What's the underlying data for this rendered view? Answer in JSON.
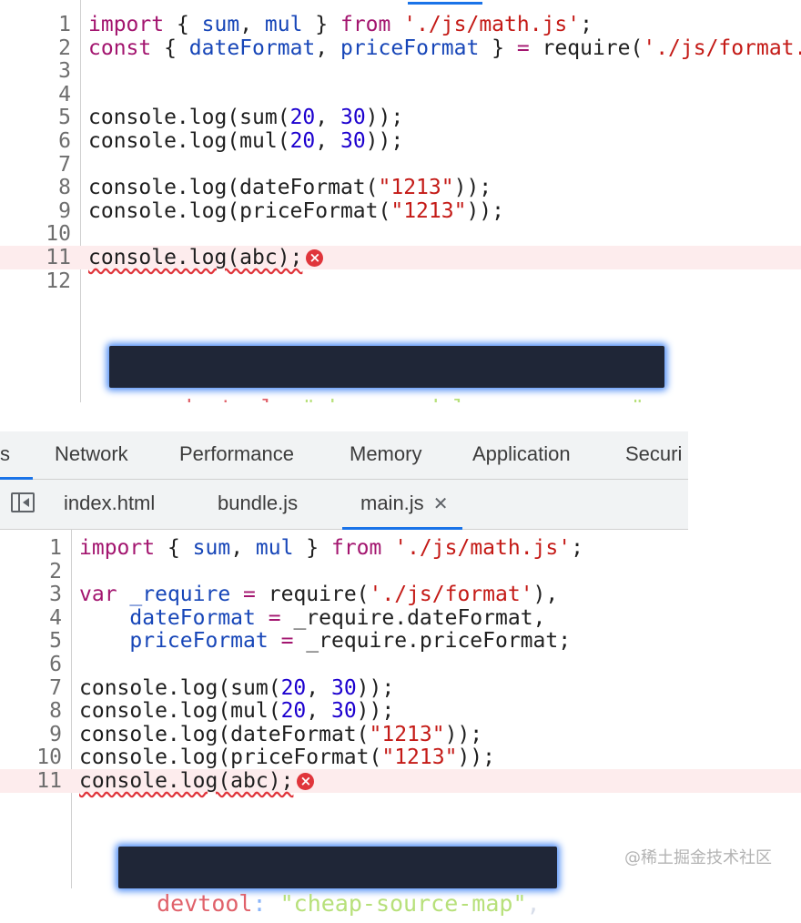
{
  "top_editor": {
    "lines": [
      {
        "no": "1",
        "tokens": [
          [
            "kw",
            "import"
          ],
          [
            "def",
            " { "
          ],
          [
            "var",
            "sum"
          ],
          [
            "def",
            ", "
          ],
          [
            "var",
            "mul"
          ],
          [
            "def",
            " } "
          ],
          [
            "kw",
            "from"
          ],
          [
            "def",
            " "
          ],
          [
            "str",
            "'./js/math.js'"
          ],
          [
            "def",
            ";"
          ]
        ]
      },
      {
        "no": "2",
        "tokens": [
          [
            "kw",
            "const"
          ],
          [
            "def",
            " { "
          ],
          [
            "var",
            "dateFormat"
          ],
          [
            "def",
            ", "
          ],
          [
            "var",
            "priceFormat"
          ],
          [
            "def",
            " } "
          ],
          [
            "op",
            "="
          ],
          [
            "def",
            " require("
          ],
          [
            "str",
            "'./js/format.js'"
          ],
          [
            "def",
            ");"
          ]
        ]
      },
      {
        "no": "3",
        "tokens": []
      },
      {
        "no": "4",
        "tokens": []
      },
      {
        "no": "5",
        "tokens": [
          [
            "def",
            "console.log(sum("
          ],
          [
            "num",
            "20"
          ],
          [
            "def",
            ", "
          ],
          [
            "num",
            "30"
          ],
          [
            "def",
            "));"
          ]
        ]
      },
      {
        "no": "6",
        "tokens": [
          [
            "def",
            "console.log(mul("
          ],
          [
            "num",
            "20"
          ],
          [
            "def",
            ", "
          ],
          [
            "num",
            "30"
          ],
          [
            "def",
            "));"
          ]
        ]
      },
      {
        "no": "7",
        "tokens": []
      },
      {
        "no": "8",
        "tokens": [
          [
            "def",
            "console.log(dateFormat("
          ],
          [
            "str",
            "\"1213\""
          ],
          [
            "def",
            "));"
          ]
        ]
      },
      {
        "no": "9",
        "tokens": [
          [
            "def",
            "console.log(priceFormat("
          ],
          [
            "str",
            "\"1213\""
          ],
          [
            "def",
            "));"
          ]
        ]
      },
      {
        "no": "10",
        "tokens": []
      },
      {
        "no": "11",
        "tokens": [
          [
            "sq",
            "console.log(abc);"
          ]
        ],
        "error": true
      },
      {
        "no": "12",
        "tokens": []
      }
    ],
    "badge": {
      "key": "devtool",
      "colon": ":",
      "value": "\"cheap-module-source-map\"",
      "comma": ","
    }
  },
  "devtools": {
    "main_tabs": [
      "s",
      "Network",
      "Performance",
      "Memory",
      "Application",
      "Securi"
    ],
    "file_tabs": [
      "index.html",
      "bundle.js",
      "main.js"
    ],
    "close_glyph": "✕"
  },
  "bottom_editor": {
    "lines": [
      {
        "no": "1",
        "tokens": [
          [
            "kw",
            "import"
          ],
          [
            "def",
            " { "
          ],
          [
            "var",
            "sum"
          ],
          [
            "def",
            ", "
          ],
          [
            "var",
            "mul"
          ],
          [
            "def",
            " } "
          ],
          [
            "kw",
            "from"
          ],
          [
            "def",
            " "
          ],
          [
            "str",
            "'./js/math.js'"
          ],
          [
            "def",
            ";"
          ]
        ]
      },
      {
        "no": "2",
        "tokens": []
      },
      {
        "no": "3",
        "tokens": [
          [
            "kw",
            "var"
          ],
          [
            "def",
            " "
          ],
          [
            "var",
            "_require"
          ],
          [
            "def",
            " "
          ],
          [
            "op",
            "="
          ],
          [
            "def",
            " require("
          ],
          [
            "str",
            "'./js/format'"
          ],
          [
            "def",
            "),"
          ]
        ]
      },
      {
        "no": "4",
        "tokens": [
          [
            "def",
            "    "
          ],
          [
            "var",
            "dateFormat"
          ],
          [
            "def",
            " "
          ],
          [
            "op",
            "="
          ],
          [
            "def",
            " _require.dateFormat,"
          ]
        ]
      },
      {
        "no": "5",
        "tokens": [
          [
            "def",
            "    "
          ],
          [
            "var",
            "priceFormat"
          ],
          [
            "def",
            " "
          ],
          [
            "op",
            "="
          ],
          [
            "def",
            " _require.priceFormat;"
          ]
        ]
      },
      {
        "no": "6",
        "tokens": []
      },
      {
        "no": "7",
        "tokens": [
          [
            "def",
            "console.log(sum("
          ],
          [
            "num",
            "20"
          ],
          [
            "def",
            ", "
          ],
          [
            "num",
            "30"
          ],
          [
            "def",
            "));"
          ]
        ]
      },
      {
        "no": "8",
        "tokens": [
          [
            "def",
            "console.log(mul("
          ],
          [
            "num",
            "20"
          ],
          [
            "def",
            ", "
          ],
          [
            "num",
            "30"
          ],
          [
            "def",
            "));"
          ]
        ]
      },
      {
        "no": "9",
        "tokens": [
          [
            "def",
            "console.log(dateFormat("
          ],
          [
            "str",
            "\"1213\""
          ],
          [
            "def",
            "));"
          ]
        ]
      },
      {
        "no": "10",
        "tokens": [
          [
            "def",
            "console.log(priceFormat("
          ],
          [
            "str",
            "\"1213\""
          ],
          [
            "def",
            "));"
          ]
        ]
      },
      {
        "no": "11",
        "tokens": [
          [
            "sq",
            "console.log(abc);"
          ]
        ],
        "error": true
      }
    ],
    "badge": {
      "key": "devtool",
      "colon": ":",
      "value": "\"cheap-source-map\"",
      "comma": ","
    }
  },
  "error_glyph": "×",
  "watermark": "@稀土掘金技术社区"
}
